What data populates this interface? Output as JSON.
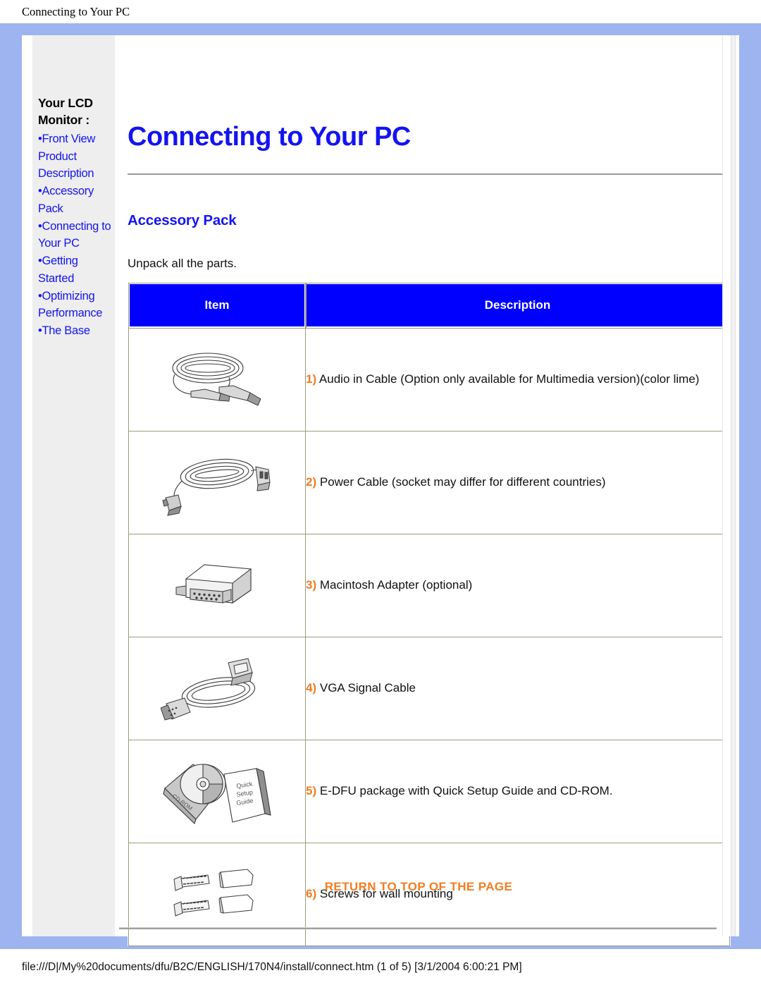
{
  "browser": {
    "header_title": "Connecting to Your PC",
    "status_bar": "file:///D|/My%20documents/dfu/B2C/ENGLISH/170N4/install/connect.htm (1 of 5) [3/1/2004 6:00:21 PM]"
  },
  "colors": {
    "frame_blue": "#9db4f0",
    "link_blue": "#1414f0",
    "header_blue": "#0000ff",
    "accent_orange": "#f47b20",
    "sidebar_gray": "#eeeeee",
    "table_border": "#9c9c78"
  },
  "sidebar": {
    "title": "Your LCD Monitor :",
    "items": [
      {
        "label": "Front View Product Description"
      },
      {
        "label": "Accessory Pack"
      },
      {
        "label": "Connecting to Your PC"
      },
      {
        "label": "Getting Started"
      },
      {
        "label": "Optimizing Performance"
      },
      {
        "label": "The Base"
      }
    ]
  },
  "main": {
    "page_title": "Connecting to Your PC",
    "section_heading": "Accessory Pack",
    "intro_text": "Unpack all the parts.",
    "return_link": "RETURN TO TOP OF THE PAGE",
    "table": {
      "columns": [
        "Item",
        "Description"
      ],
      "rows": [
        {
          "index": "1)",
          "icon": "audio-cable-icon",
          "description": "Audio in Cable (Option only available for Multimedia version)(color lime)"
        },
        {
          "index": "2)",
          "icon": "power-cable-icon",
          "description": "Power Cable (socket may differ for different countries)"
        },
        {
          "index": "3)",
          "icon": "macintosh-adapter-icon",
          "description": "Macintosh Adapter (optional)"
        },
        {
          "index": "4)",
          "icon": "vga-signal-cable-icon",
          "description": "VGA Signal Cable"
        },
        {
          "index": "5)",
          "icon": "cdrom-package-icon",
          "description": "E-DFU package with Quick Setup Guide and CD-ROM."
        },
        {
          "index": "6)",
          "icon": "screws-icon",
          "description": "Screws for wall mounting"
        }
      ]
    }
  }
}
